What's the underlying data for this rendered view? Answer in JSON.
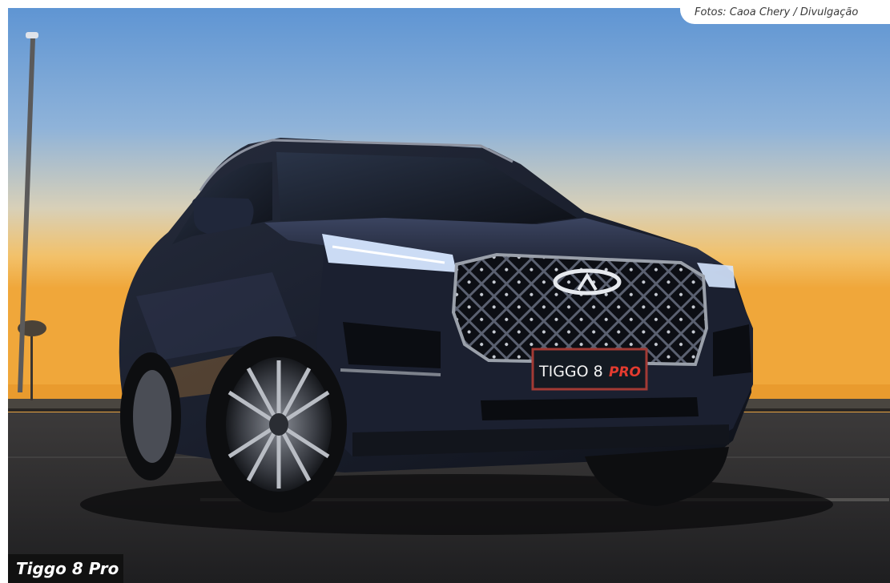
{
  "photo": {
    "credit": "Fotos: Caoa Chery / Divulgação",
    "caption": "Tiggo 8 Pro",
    "plate_text_main": "TIGGO 8",
    "plate_text_accent": "PRO",
    "colors": {
      "sky_top": "#6d9fd6",
      "sky_horizon": "#f3b548",
      "car_body": "#1b2030",
      "plate_accent": "#e43b2f"
    }
  }
}
